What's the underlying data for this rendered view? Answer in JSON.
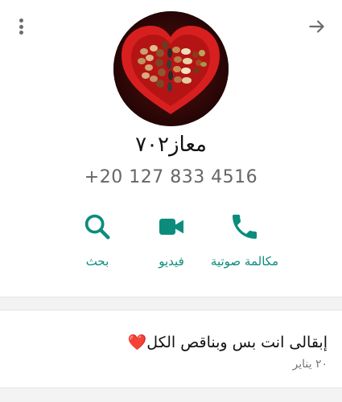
{
  "header": {
    "menu_icon": "more-vert-icon",
    "back_icon": "arrow-forward-icon"
  },
  "contact": {
    "name": "معاز٧٠٢",
    "phone": "+20 127 833 4516",
    "avatar_icon": "nuts-heart-photo"
  },
  "actions": [
    {
      "label": "بحث",
      "icon": "search-icon"
    },
    {
      "label": "فيديو",
      "icon": "video-icon"
    },
    {
      "label": "مكالمة صوتية",
      "icon": "phone-icon"
    }
  ],
  "about": {
    "text": "إبقالى انت بس وبناقص الكل",
    "emoji": "❤️",
    "date": "٢٠ يناير"
  },
  "colors": {
    "accent": "#0b8c7c",
    "heart": "#e0233a"
  }
}
